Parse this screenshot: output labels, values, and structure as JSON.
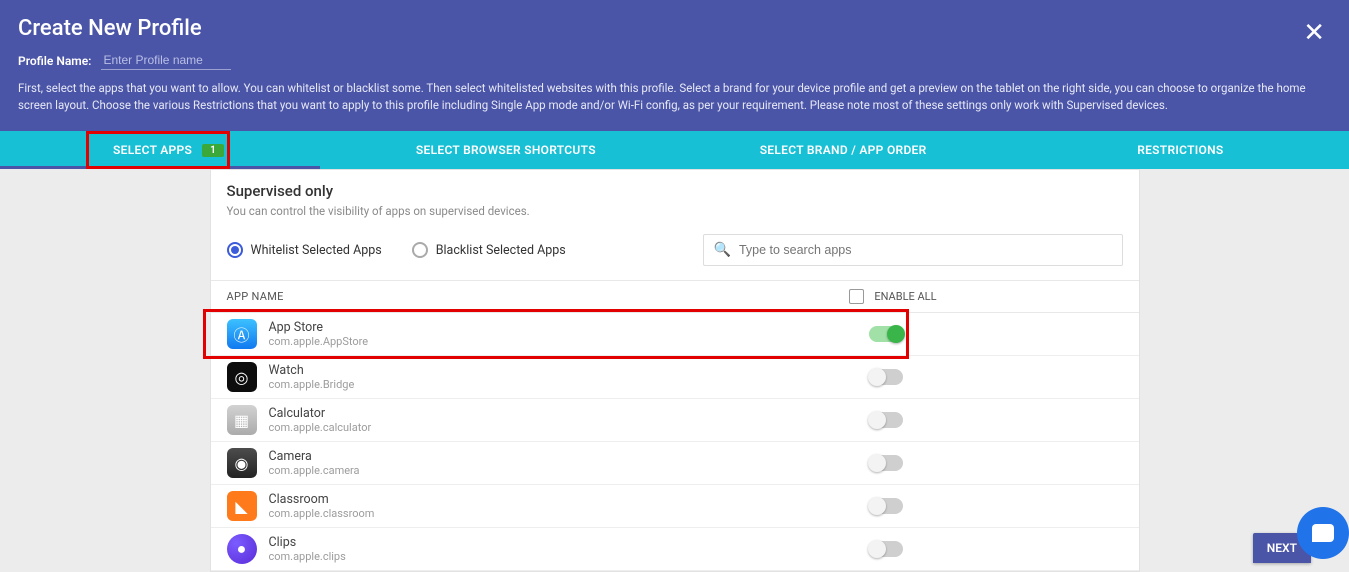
{
  "header": {
    "title": "Create New Profile",
    "profile_label": "Profile Name:",
    "profile_placeholder": "Enter Profile name",
    "description": "First, select the apps that you want to allow. You can whitelist or blacklist some. Then select whitelisted websites with this profile. Select a brand for your device profile and get a preview on the tablet on the right side, you can choose to organize the home screen layout. Choose the various Restrictions that you want to apply to this profile including Single App mode and/or Wi-Fi config, as per your requirement. Please note most of these settings only work with Supervised devices."
  },
  "tabs": {
    "items": [
      {
        "label": "SELECT APPS",
        "badge": "1",
        "active": true
      },
      {
        "label": "SELECT BROWSER SHORTCUTS"
      },
      {
        "label": "SELECT BRAND / APP ORDER"
      },
      {
        "label": "RESTRICTIONS"
      }
    ]
  },
  "panel": {
    "heading": "Supervised only",
    "sub": "You can control the visibility of apps on supervised devices.",
    "radio_whitelist": "Whitelist Selected Apps",
    "radio_blacklist": "Blacklist Selected Apps",
    "search_placeholder": "Type to search apps",
    "col_appname": "APP NAME",
    "col_enable": "ENABLE ALL"
  },
  "apps": [
    {
      "name": "App Store",
      "id": "com.apple.AppStore",
      "on": true,
      "highlight": true,
      "icon": "appstore",
      "glyph": "Ⓐ"
    },
    {
      "name": "Watch",
      "id": "com.apple.Bridge",
      "on": false,
      "icon": "watch",
      "glyph": "◎"
    },
    {
      "name": "Calculator",
      "id": "com.apple.calculator",
      "on": false,
      "icon": "calc",
      "glyph": "▦"
    },
    {
      "name": "Camera",
      "id": "com.apple.camera",
      "on": false,
      "icon": "camera",
      "glyph": "◉"
    },
    {
      "name": "Classroom",
      "id": "com.apple.classroom",
      "on": false,
      "icon": "classroom",
      "glyph": "◣"
    },
    {
      "name": "Clips",
      "id": "com.apple.clips",
      "on": false,
      "icon": "clips",
      "glyph": "●"
    }
  ],
  "footer": {
    "next": "NEXT"
  }
}
